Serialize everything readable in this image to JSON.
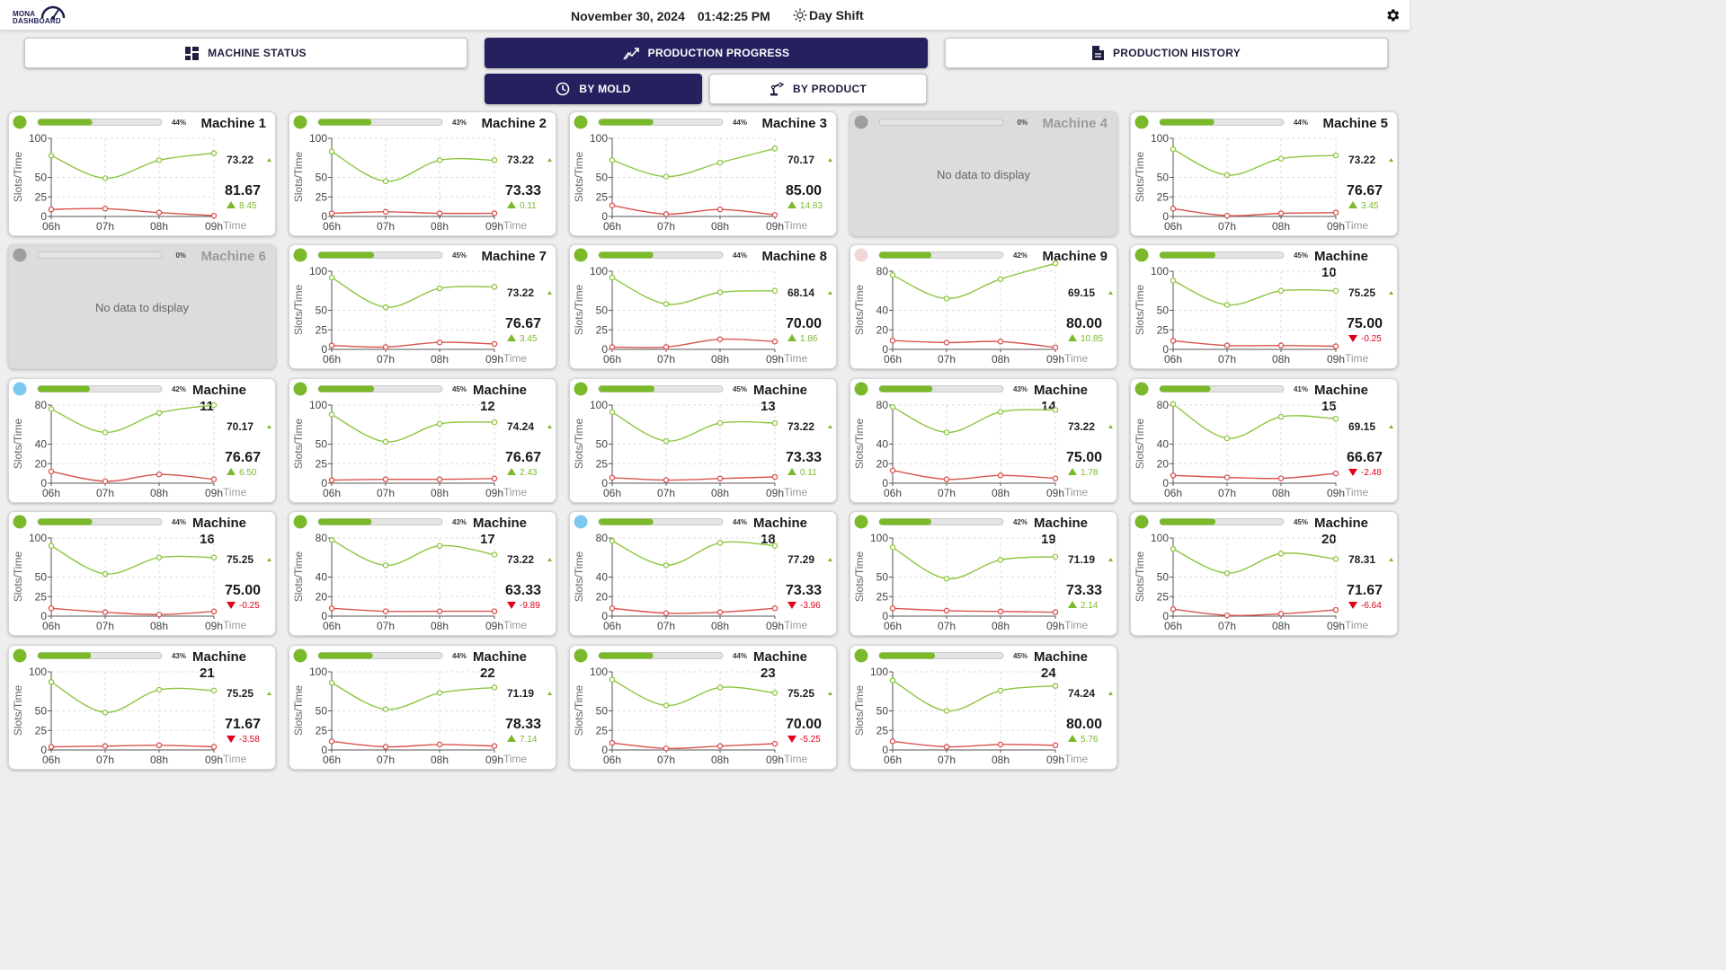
{
  "header": {
    "logo_line1": "MONA",
    "logo_line2": "DASHBOARD",
    "date": "November 30, 2024",
    "time": "01:42:25 PM",
    "shift": "Day Shift"
  },
  "nav": {
    "machine_status": "MACHINE STATUS",
    "production_progress": "PRODUCTION PROGRESS",
    "production_history": "PRODUCTION HISTORY",
    "by_mold": "BY MOLD",
    "by_product": "BY PRODUCT"
  },
  "chart_common": {
    "ylabel": "Slots/Time",
    "xlabel": "Time",
    "x_ticks": [
      "06h",
      "07h",
      "08h",
      "09h"
    ],
    "no_data": "No data to display",
    "colors": {
      "target_line": "#8cc63f",
      "actual_line": "#d9534f",
      "up": "#7ab929",
      "down": "#e0001a",
      "status_green": "#7ab929",
      "status_blue": "#7cc8f0",
      "status_gray": "#9e9e9e",
      "status_pink": "#f2d7d7"
    }
  },
  "chart_data": [
    {
      "type": "line",
      "name": "Machine 1",
      "status": "green",
      "progress": 44,
      "progress_label": "44%",
      "yticks": [
        0,
        25,
        50,
        100
      ],
      "ylim": [
        0,
        100
      ],
      "ref_value": "73.22",
      "main_value": "81.67",
      "delta": "8.45",
      "trend": "up",
      "series": [
        {
          "name": "upper",
          "values": [
            78,
            49,
            72,
            81
          ]
        },
        {
          "name": "lower",
          "values": [
            9,
            10,
            5,
            1
          ]
        }
      ]
    },
    {
      "type": "line",
      "name": "Machine 2",
      "status": "green",
      "progress": 43,
      "progress_label": "43%",
      "yticks": [
        0,
        25,
        50,
        100
      ],
      "ylim": [
        0,
        100
      ],
      "ref_value": "73.22",
      "main_value": "73.33",
      "delta": "0.11",
      "trend": "up",
      "series": [
        {
          "name": "upper",
          "values": [
            83,
            45,
            72,
            72
          ]
        },
        {
          "name": "lower",
          "values": [
            4,
            6,
            4,
            4
          ]
        }
      ]
    },
    {
      "type": "line",
      "name": "Machine 3",
      "status": "green",
      "progress": 44,
      "progress_label": "44%",
      "yticks": [
        0,
        25,
        50,
        100
      ],
      "ylim": [
        0,
        100
      ],
      "ref_value": "70.17",
      "main_value": "85.00",
      "delta": "14.83",
      "trend": "up",
      "series": [
        {
          "name": "upper",
          "values": [
            72,
            51,
            69,
            87
          ]
        },
        {
          "name": "lower",
          "values": [
            14,
            3,
            9,
            2
          ]
        }
      ]
    },
    {
      "type": "line",
      "name": "Machine 4",
      "status": "gray",
      "progress": 0,
      "progress_label": "0%",
      "nodata": true
    },
    {
      "type": "line",
      "name": "Machine 5",
      "status": "green",
      "progress": 44,
      "progress_label": "44%",
      "yticks": [
        0,
        25,
        50,
        100
      ],
      "ylim": [
        0,
        100
      ],
      "ref_value": "73.22",
      "main_value": "76.67",
      "delta": "3.45",
      "trend": "up",
      "series": [
        {
          "name": "upper",
          "values": [
            86,
            53,
            74,
            78
          ]
        },
        {
          "name": "lower",
          "values": [
            10,
            1,
            4,
            5
          ]
        }
      ]
    },
    {
      "type": "line",
      "name": "Machine 6",
      "status": "gray",
      "progress": 0,
      "progress_label": "0%",
      "nodata": true
    },
    {
      "type": "line",
      "name": "Machine 7",
      "status": "green",
      "progress": 45,
      "progress_label": "45%",
      "yticks": [
        0,
        25,
        50,
        100
      ],
      "ylim": [
        0,
        100
      ],
      "ref_value": "73.22",
      "main_value": "76.67",
      "delta": "3.45",
      "trend": "up",
      "series": [
        {
          "name": "upper",
          "values": [
            92,
            54,
            78,
            80
          ]
        },
        {
          "name": "lower",
          "values": [
            5,
            3,
            9,
            7
          ]
        }
      ]
    },
    {
      "type": "line",
      "name": "Machine 8",
      "status": "green",
      "progress": 44,
      "progress_label": "44%",
      "yticks": [
        0,
        25,
        50,
        100
      ],
      "ylim": [
        0,
        100
      ],
      "ref_value": "68.14",
      "main_value": "70.00",
      "delta": "1.86",
      "trend": "up",
      "series": [
        {
          "name": "upper",
          "values": [
            92,
            58,
            73,
            75
          ]
        },
        {
          "name": "lower",
          "values": [
            3,
            3,
            13,
            10
          ]
        }
      ]
    },
    {
      "type": "line",
      "name": "Machine 9",
      "status": "pink",
      "progress": 42,
      "progress_label": "42%",
      "yticks": [
        0,
        20,
        40,
        80
      ],
      "ylim": [
        0,
        80
      ],
      "ref_value": "69.15",
      "main_value": "80.00",
      "delta": "10.85",
      "trend": "up",
      "series": [
        {
          "name": "upper",
          "values": [
            76,
            52,
            72,
            88
          ]
        },
        {
          "name": "lower",
          "values": [
            9,
            7,
            8,
            2
          ]
        }
      ]
    },
    {
      "type": "line",
      "name": "Machine 10",
      "status": "green",
      "progress": 45,
      "progress_label": "45%",
      "yticks": [
        0,
        25,
        50,
        100
      ],
      "ylim": [
        0,
        100
      ],
      "ref_value": "75.25",
      "main_value": "75.00",
      "delta": "-0.25",
      "trend": "down",
      "series": [
        {
          "name": "upper",
          "values": [
            88,
            57,
            75,
            75
          ]
        },
        {
          "name": "lower",
          "values": [
            11,
            5,
            5,
            4
          ]
        }
      ]
    },
    {
      "type": "line",
      "name": "Machine 11",
      "status": "blue",
      "progress": 42,
      "progress_label": "42%",
      "yticks": [
        0,
        20,
        40,
        80
      ],
      "ylim": [
        0,
        80
      ],
      "ref_value": "70.17",
      "main_value": "76.67",
      "delta": "6.50",
      "trend": "up",
      "series": [
        {
          "name": "upper",
          "values": [
            76,
            52,
            72,
            80
          ]
        },
        {
          "name": "lower",
          "values": [
            12,
            2,
            9,
            4
          ]
        }
      ]
    },
    {
      "type": "line",
      "name": "Machine 12",
      "status": "green",
      "progress": 45,
      "progress_label": "45%",
      "yticks": [
        0,
        25,
        50,
        100
      ],
      "ylim": [
        0,
        100
      ],
      "ref_value": "74.24",
      "main_value": "76.67",
      "delta": "2.43",
      "trend": "up",
      "series": [
        {
          "name": "upper",
          "values": [
            88,
            53,
            76,
            78
          ]
        },
        {
          "name": "lower",
          "values": [
            4,
            5,
            5,
            6
          ]
        }
      ]
    },
    {
      "type": "line",
      "name": "Machine 13",
      "status": "green",
      "progress": 45,
      "progress_label": "45%",
      "yticks": [
        0,
        25,
        50,
        100
      ],
      "ylim": [
        0,
        100
      ],
      "ref_value": "73.22",
      "main_value": "73.33",
      "delta": "0.11",
      "trend": "up",
      "series": [
        {
          "name": "upper",
          "values": [
            91,
            54,
            77,
            77
          ]
        },
        {
          "name": "lower",
          "values": [
            7,
            4,
            6,
            8
          ]
        }
      ]
    },
    {
      "type": "line",
      "name": "Machine 14",
      "status": "green",
      "progress": 43,
      "progress_label": "43%",
      "yticks": [
        0,
        20,
        40,
        80
      ],
      "ylim": [
        0,
        80
      ],
      "ref_value": "73.22",
      "main_value": "75.00",
      "delta": "1.78",
      "trend": "up",
      "series": [
        {
          "name": "upper",
          "values": [
            78,
            52,
            73,
            75
          ]
        },
        {
          "name": "lower",
          "values": [
            13,
            4,
            8,
            5
          ]
        }
      ]
    },
    {
      "type": "line",
      "name": "Machine 15",
      "status": "green",
      "progress": 41,
      "progress_label": "41%",
      "yticks": [
        0,
        20,
        40,
        80
      ],
      "ylim": [
        0,
        80
      ],
      "ref_value": "69.15",
      "main_value": "66.67",
      "delta": "-2.48",
      "trend": "down",
      "series": [
        {
          "name": "upper",
          "values": [
            81,
            46,
            68,
            66
          ]
        },
        {
          "name": "lower",
          "values": [
            8,
            6,
            5,
            10
          ]
        }
      ]
    },
    {
      "type": "line",
      "name": "Machine 16",
      "status": "green",
      "progress": 44,
      "progress_label": "44%",
      "yticks": [
        0,
        25,
        50,
        100
      ],
      "ylim": [
        0,
        100
      ],
      "ref_value": "75.25",
      "main_value": "75.00",
      "delta": "-0.25",
      "trend": "down",
      "series": [
        {
          "name": "upper",
          "values": [
            90,
            54,
            75,
            75
          ]
        },
        {
          "name": "lower",
          "values": [
            10,
            5,
            2,
            6
          ]
        }
      ]
    },
    {
      "type": "line",
      "name": "Machine 17",
      "status": "green",
      "progress": 43,
      "progress_label": "43%",
      "yticks": [
        0,
        20,
        40,
        80
      ],
      "ylim": [
        0,
        80
      ],
      "ref_value": "73.22",
      "main_value": "63.33",
      "delta": "-9.89",
      "trend": "down",
      "series": [
        {
          "name": "upper",
          "values": [
            78,
            52,
            72,
            63
          ]
        },
        {
          "name": "lower",
          "values": [
            8,
            5,
            5,
            5
          ]
        }
      ]
    },
    {
      "type": "line",
      "name": "Machine 18",
      "status": "blue",
      "progress": 44,
      "progress_label": "44%",
      "yticks": [
        0,
        20,
        40,
        80
      ],
      "ylim": [
        0,
        80
      ],
      "ref_value": "77.29",
      "main_value": "73.33",
      "delta": "-3.96",
      "trend": "down",
      "series": [
        {
          "name": "upper",
          "values": [
            77,
            52,
            75,
            72
          ]
        },
        {
          "name": "lower",
          "values": [
            8,
            3,
            4,
            8
          ]
        }
      ]
    },
    {
      "type": "line",
      "name": "Machine 19",
      "status": "green",
      "progress": 42,
      "progress_label": "42%",
      "yticks": [
        0,
        25,
        50,
        100
      ],
      "ylim": [
        0,
        100
      ],
      "ref_value": "71.19",
      "main_value": "73.33",
      "delta": "2.14",
      "trend": "up",
      "series": [
        {
          "name": "upper",
          "values": [
            88,
            48,
            72,
            76
          ]
        },
        {
          "name": "lower",
          "values": [
            10,
            7,
            6,
            5
          ]
        }
      ]
    },
    {
      "type": "line",
      "name": "Machine 20",
      "status": "green",
      "progress": 45,
      "progress_label": "45%",
      "yticks": [
        0,
        25,
        50,
        100
      ],
      "ylim": [
        0,
        100
      ],
      "ref_value": "78.31",
      "main_value": "71.67",
      "delta": "-6.64",
      "trend": "down",
      "series": [
        {
          "name": "upper",
          "values": [
            86,
            55,
            80,
            73
          ]
        },
        {
          "name": "lower",
          "values": [
            9,
            1,
            3,
            8
          ]
        }
      ]
    },
    {
      "type": "line",
      "name": "Machine 21",
      "status": "green",
      "progress": 43,
      "progress_label": "43%",
      "yticks": [
        0,
        25,
        50,
        100
      ],
      "ylim": [
        0,
        100
      ],
      "ref_value": "75.25",
      "main_value": "71.67",
      "delta": "-3.58",
      "trend": "down",
      "series": [
        {
          "name": "upper",
          "values": [
            87,
            48,
            77,
            76
          ]
        },
        {
          "name": "lower",
          "values": [
            4,
            5,
            6,
            4
          ]
        }
      ]
    },
    {
      "type": "line",
      "name": "Machine 22",
      "status": "green",
      "progress": 44,
      "progress_label": "44%",
      "yticks": [
        0,
        25,
        50,
        100
      ],
      "ylim": [
        0,
        100
      ],
      "ref_value": "71.19",
      "main_value": "78.33",
      "delta": "7.14",
      "trend": "up",
      "series": [
        {
          "name": "upper",
          "values": [
            86,
            52,
            73,
            80
          ]
        },
        {
          "name": "lower",
          "values": [
            11,
            4,
            7,
            5
          ]
        }
      ]
    },
    {
      "type": "line",
      "name": "Machine 23",
      "status": "green",
      "progress": 44,
      "progress_label": "44%",
      "yticks": [
        0,
        25,
        50,
        100
      ],
      "ylim": [
        0,
        100
      ],
      "ref_value": "75.25",
      "main_value": "70.00",
      "delta": "-5.25",
      "trend": "down",
      "series": [
        {
          "name": "upper",
          "values": [
            90,
            57,
            80,
            73
          ]
        },
        {
          "name": "lower",
          "values": [
            9,
            2,
            5,
            8
          ]
        }
      ]
    },
    {
      "type": "line",
      "name": "Machine 24",
      "status": "green",
      "progress": 45,
      "progress_label": "45%",
      "yticks": [
        0,
        25,
        50,
        100
      ],
      "ylim": [
        0,
        100
      ],
      "ref_value": "74.24",
      "main_value": "80.00",
      "delta": "5.76",
      "trend": "up",
      "series": [
        {
          "name": "upper",
          "values": [
            89,
            50,
            76,
            82
          ]
        },
        {
          "name": "lower",
          "values": [
            11,
            4,
            7,
            6
          ]
        }
      ]
    }
  ]
}
